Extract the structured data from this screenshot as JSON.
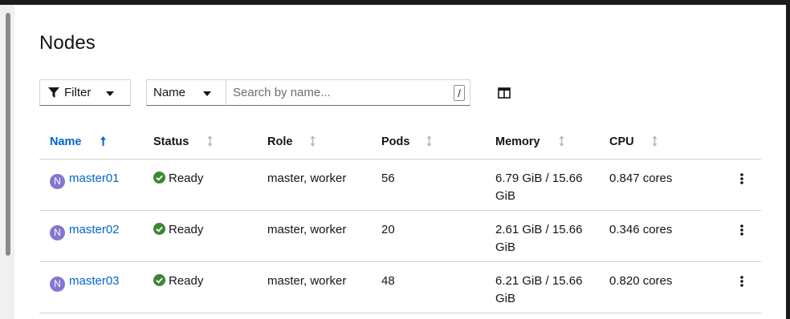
{
  "page": {
    "title": "Nodes"
  },
  "toolbar": {
    "filter_label": "Filter",
    "search_by_label": "Name",
    "search_placeholder": "Search by name...",
    "shortcut_key": "/"
  },
  "table": {
    "columns": [
      "Name",
      "Status",
      "Role",
      "Pods",
      "Memory",
      "CPU"
    ],
    "rows": [
      {
        "badge": "N",
        "name": "master01",
        "status": "Ready",
        "role": "master, worker",
        "pods": "56",
        "memory": "6.79 GiB / 15.66 GiB",
        "cpu": "0.847 cores"
      },
      {
        "badge": "N",
        "name": "master02",
        "status": "Ready",
        "role": "master, worker",
        "pods": "20",
        "memory": "2.61 GiB / 15.66 GiB",
        "cpu": "0.346 cores"
      },
      {
        "badge": "N",
        "name": "master03",
        "status": "Ready",
        "role": "master, worker",
        "pods": "48",
        "memory": "6.21 GiB / 15.66 GiB",
        "cpu": "0.820 cores"
      }
    ]
  },
  "icons": {
    "filter": "filter-icon",
    "caret": "caret-down-icon",
    "columns": "columns-icon",
    "sort_active": "sort-ascending-icon",
    "sort_inactive": "sort-icon",
    "status_ok": "check-circle-icon",
    "row_actions": "kebab-icon"
  },
  "colors": {
    "link": "#0066cc",
    "node_badge": "#8476d1",
    "status_ok": "#3e8635"
  }
}
